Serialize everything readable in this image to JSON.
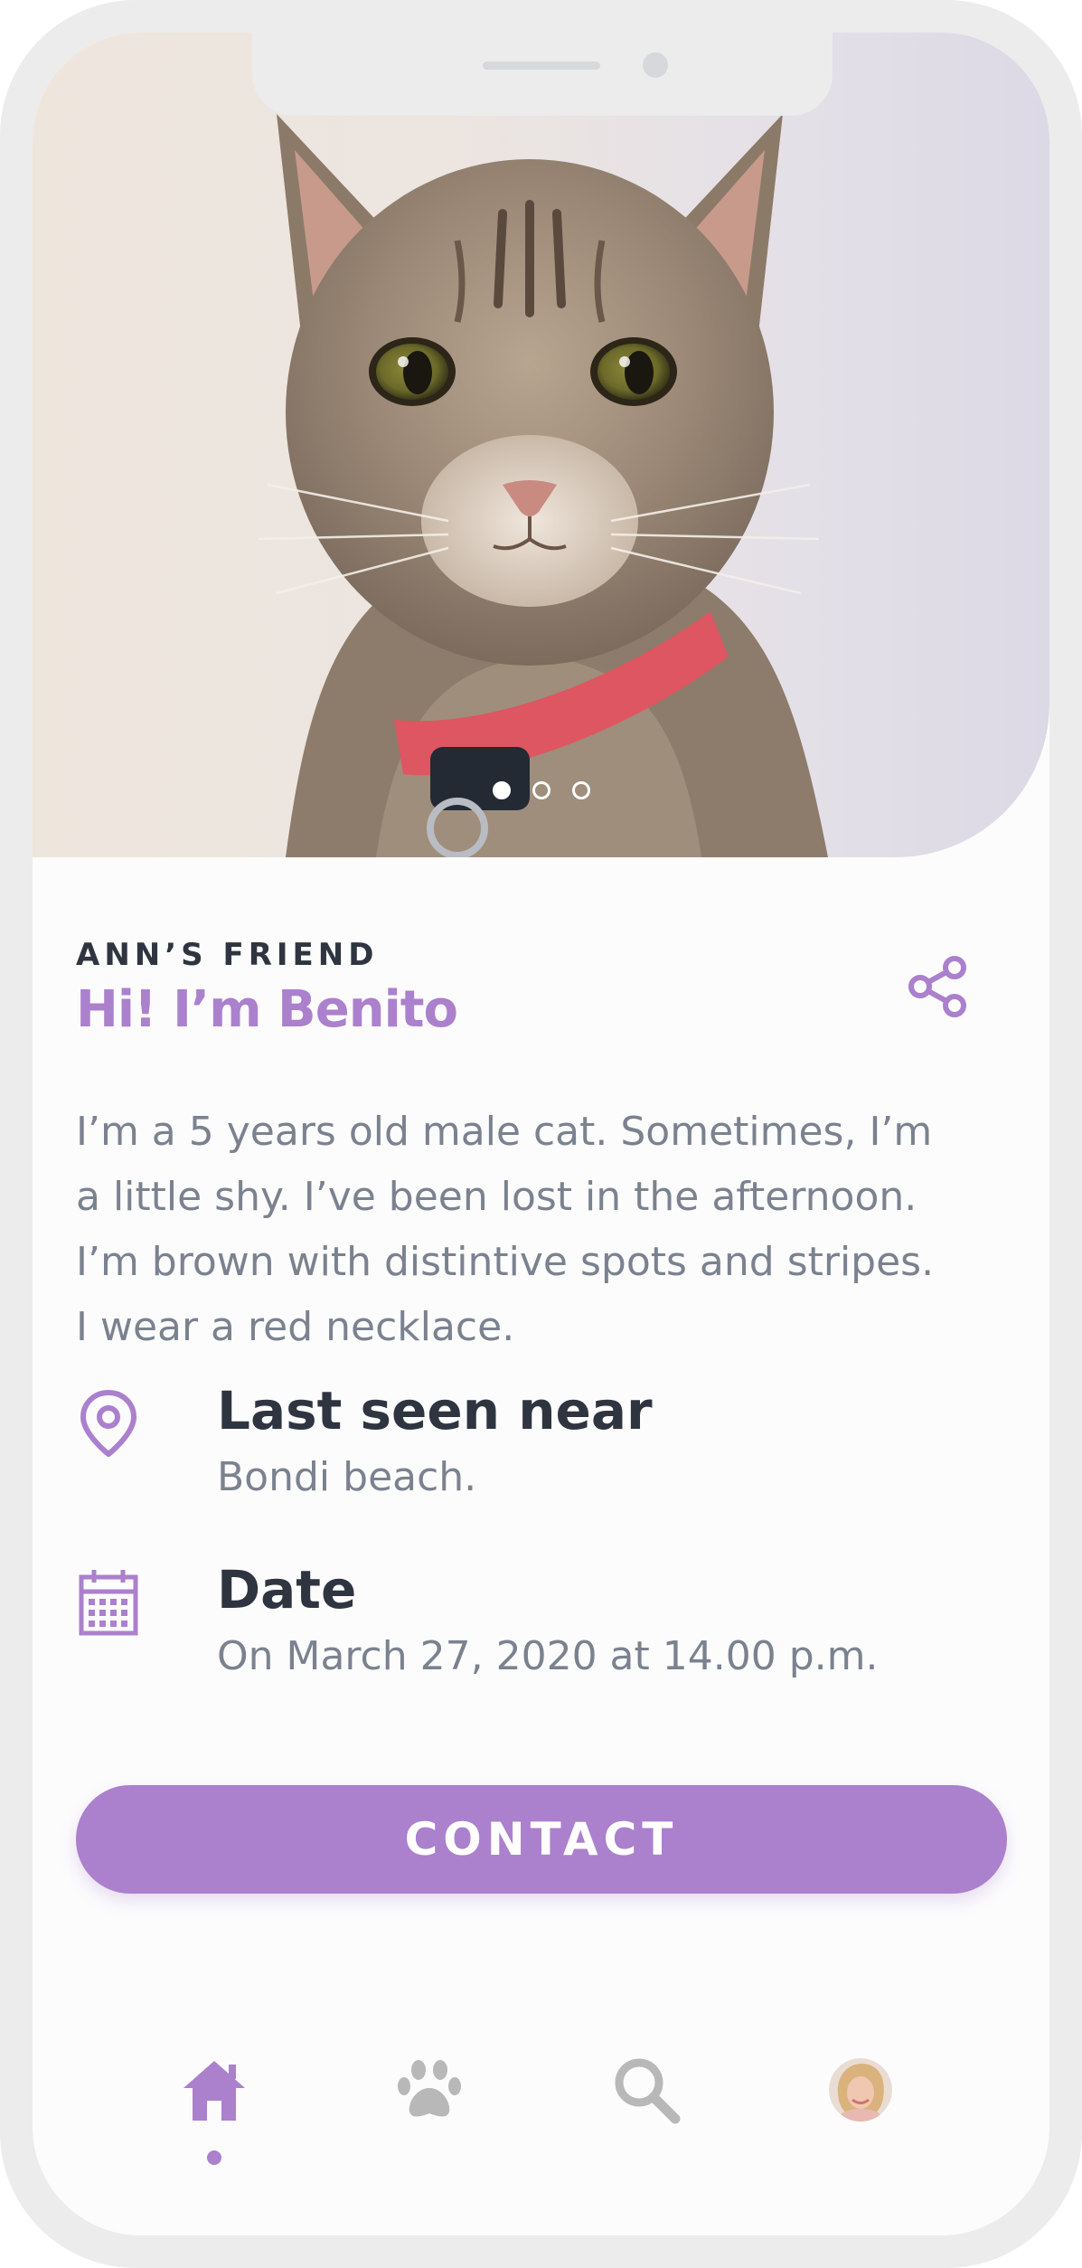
{
  "colors": {
    "accent": "#ab80cd",
    "heading": "#2f3540",
    "body_text": "#7b828f",
    "inactive_icon": "#b8b8b8"
  },
  "photo": {
    "subject": "cat-photo",
    "pager_pages": 3,
    "pager_active_index": 0
  },
  "profile": {
    "eyebrow": "ANN’S FRIEND",
    "title": "Hi! I’m Benito",
    "description_lines": [
      "I’m a 5 years old male cat. Sometimes, I’m",
      "a little shy. I’ve been lost in the afternoon.",
      "I’m brown with distintive spots and stripes.",
      "I wear a red necklace."
    ],
    "share_icon": "share-icon"
  },
  "details": {
    "location": {
      "icon": "map-pin-icon",
      "label": "Last seen near",
      "value": "Bondi beach."
    },
    "date": {
      "icon": "calendar-icon",
      "label": "Date",
      "value": "On March 27, 2020 at 14.00 p.m."
    }
  },
  "actions": {
    "contact_label": "CONTACT"
  },
  "tabbar": {
    "active_index": 0,
    "tabs": [
      {
        "icon": "home-icon"
      },
      {
        "icon": "paw-icon"
      },
      {
        "icon": "search-icon"
      },
      {
        "icon": "avatar"
      }
    ]
  }
}
